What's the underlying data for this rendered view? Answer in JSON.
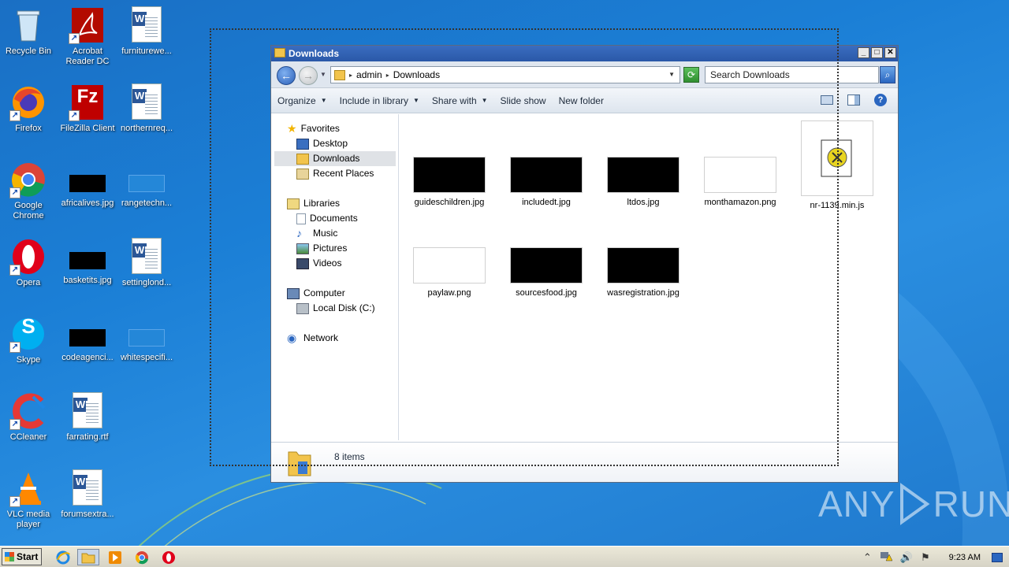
{
  "desktop": {
    "icons": [
      {
        "label": "Recycle Bin"
      },
      {
        "label": "Acrobat Reader DC"
      },
      {
        "label": "furniturewe..."
      },
      {
        "label": "Firefox"
      },
      {
        "label": "FileZilla Client"
      },
      {
        "label": "northernreq..."
      },
      {
        "label": "Google Chrome"
      },
      {
        "label": "africalives.jpg"
      },
      {
        "label": "rangetechn..."
      },
      {
        "label": "Opera"
      },
      {
        "label": "basketits.jpg"
      },
      {
        "label": "settinglond..."
      },
      {
        "label": "Skype"
      },
      {
        "label": "codeagenci..."
      },
      {
        "label": "whitespecifi..."
      },
      {
        "label": "CCleaner"
      },
      {
        "label": "farrating.rtf"
      },
      {
        "label": "VLC media player"
      },
      {
        "label": "forumsextra..."
      }
    ],
    "app_letters": {
      "filezilla": "Fz",
      "skype": "S",
      "word": "W"
    }
  },
  "window": {
    "title": "Downloads",
    "buttons": {
      "minimize": "_",
      "maximize": "□",
      "close": "✕"
    },
    "address": {
      "crumbs": [
        "admin",
        "Downloads"
      ],
      "back_glyph": "←",
      "forward_glyph": "→",
      "refresh_glyph": "⟳"
    },
    "search": {
      "placeholder": "Search Downloads",
      "button_glyph": "⌕"
    },
    "toolbar": {
      "organize": "Organize",
      "include_in_library": "Include in library",
      "share_with": "Share with",
      "slide_show": "Slide show",
      "new_folder": "New folder",
      "help_glyph": "?"
    },
    "navigation": {
      "favorites": "Favorites",
      "desktop": "Desktop",
      "downloads": "Downloads",
      "recent_places": "Recent Places",
      "libraries": "Libraries",
      "documents": "Documents",
      "music": "Music",
      "pictures": "Pictures",
      "videos": "Videos",
      "computer": "Computer",
      "local_disk": "Local Disk (C:)",
      "network": "Network"
    },
    "files": [
      {
        "name": "guideschildren.jpg",
        "thumb": "#000000"
      },
      {
        "name": "includedt.jpg",
        "thumb": "#000000"
      },
      {
        "name": "ltdos.jpg",
        "thumb": "#000000"
      },
      {
        "name": "monthamazon.png",
        "thumb": "#ffffff"
      },
      {
        "name": "nr-1139.min.js",
        "thumb": "script"
      },
      {
        "name": "paylaw.png",
        "thumb": "#ffffff"
      },
      {
        "name": "sourcesfood.jpg",
        "thumb": "#000000"
      },
      {
        "name": "wasregistration.jpg",
        "thumb": "#000000"
      }
    ],
    "status": "8 items"
  },
  "taskbar": {
    "start_label": "Start",
    "clock": "9:23 AM",
    "tray_glyphs": {
      "expand": "⌃",
      "speaker": "🔊",
      "flag": "⚑"
    }
  },
  "watermark": {
    "left": "ANY",
    "right": "RUN"
  },
  "colors": {
    "desktop_bg": "#1b7fd6",
    "title_bar": "#2a58a8",
    "selection": "#dfe2e6"
  }
}
